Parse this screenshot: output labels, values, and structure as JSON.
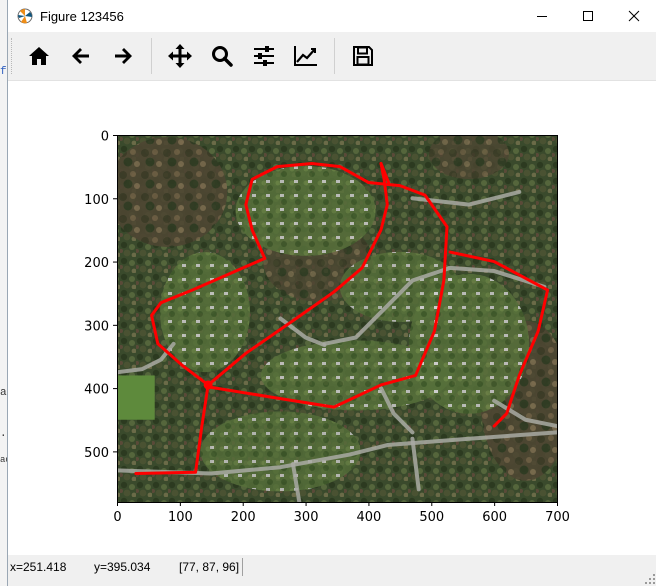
{
  "window": {
    "title": "Figure 123456",
    "controls": {
      "minimize": "minimize",
      "maximize": "maximize",
      "close": "close"
    }
  },
  "toolbar": {
    "buttons": [
      {
        "name": "home-button",
        "icon": "home-icon"
      },
      {
        "name": "back-button",
        "icon": "arrow-left-icon"
      },
      {
        "name": "forward-button",
        "icon": "arrow-right-icon"
      },
      {
        "name": "pan-button",
        "icon": "move-icon"
      },
      {
        "name": "zoom-button",
        "icon": "magnifier-icon"
      },
      {
        "name": "subplots-button",
        "icon": "sliders-icon"
      },
      {
        "name": "edit-axes-button",
        "icon": "line-chart-icon"
      },
      {
        "name": "save-button",
        "icon": "floppy-disk-icon"
      }
    ]
  },
  "plot": {
    "xticks": [
      "0",
      "100",
      "200",
      "300",
      "400",
      "500",
      "600",
      "700"
    ],
    "yticks": [
      "0",
      "100",
      "200",
      "300",
      "400",
      "500"
    ],
    "xlim": [
      0,
      700
    ],
    "ylim": [
      580,
      0
    ],
    "image": "aerial photograph of a wooded residential neighborhood with curving streets",
    "overlay_color": "#ff0000",
    "overlay_paths": [
      [
        [
          30,
          535
        ],
        [
          125,
          533
        ],
        [
          135,
          460
        ],
        [
          145,
          395
        ]
      ],
      [
        [
          145,
          395
        ],
        [
          105,
          365
        ],
        [
          65,
          330
        ],
        [
          55,
          285
        ],
        [
          70,
          265
        ],
        [
          120,
          245
        ],
        [
          235,
          195
        ]
      ],
      [
        [
          235,
          195
        ],
        [
          215,
          150
        ],
        [
          205,
          110
        ],
        [
          215,
          70
        ],
        [
          255,
          50
        ],
        [
          310,
          45
        ],
        [
          355,
          50
        ],
        [
          400,
          75
        ]
      ],
      [
        [
          400,
          75
        ],
        [
          450,
          80
        ],
        [
          490,
          95
        ],
        [
          525,
          145
        ],
        [
          520,
          230
        ],
        [
          505,
          310
        ],
        [
          490,
          345
        ],
        [
          475,
          380
        ],
        [
          420,
          395
        ],
        [
          345,
          430
        ],
        [
          250,
          415
        ],
        [
          145,
          398
        ]
      ],
      [
        [
          145,
          395
        ],
        [
          205,
          345
        ],
        [
          285,
          290
        ],
        [
          345,
          248
        ],
        [
          390,
          210
        ],
        [
          420,
          150
        ],
        [
          430,
          110
        ],
        [
          425,
          70
        ],
        [
          420,
          45
        ]
      ],
      [
        [
          420,
          45
        ],
        [
          432,
          75
        ]
      ],
      [
        [
          530,
          185
        ],
        [
          600,
          200
        ],
        [
          685,
          245
        ],
        [
          670,
          310
        ],
        [
          640,
          380
        ],
        [
          620,
          440
        ],
        [
          600,
          460
        ]
      ]
    ]
  },
  "status": {
    "x": "x=251.418",
    "y": "y=395.034",
    "rgb": "[77, 87, 96]"
  },
  "background_app": {
    "fragments": [
      "f",
      "a",
      ".",
      "ad"
    ]
  }
}
